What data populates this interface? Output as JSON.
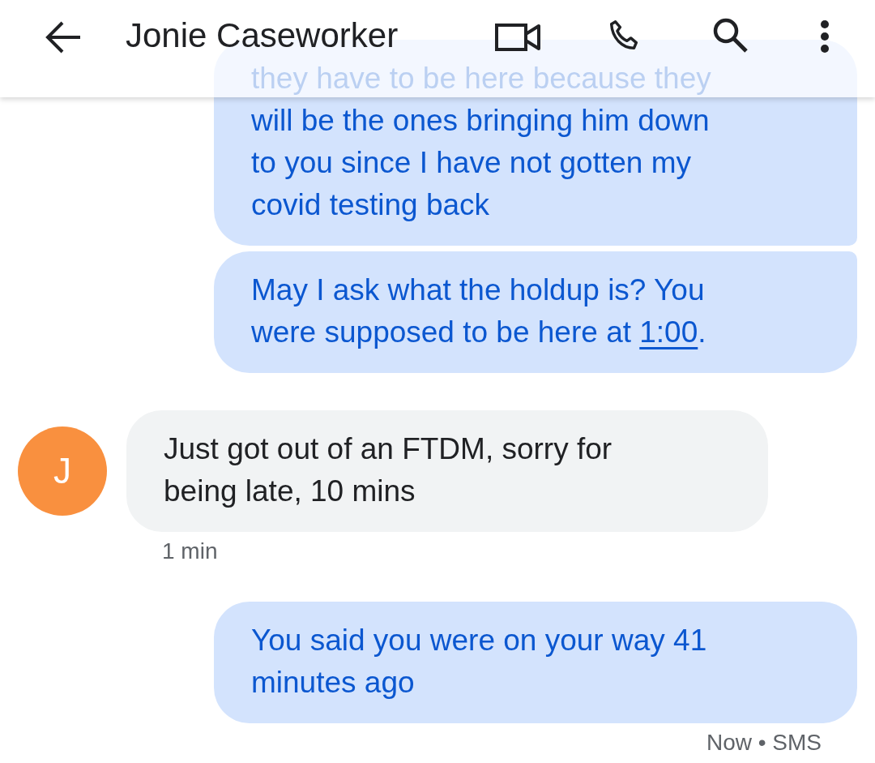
{
  "header": {
    "title": "Jonie Caseworker"
  },
  "messages": [
    {
      "kind": "sent",
      "lines": [
        [
          {
            "kind": "text",
            "text": "they have to be here because they"
          }
        ],
        [
          {
            "kind": "text",
            "text": "will be the ones bringing him down"
          }
        ],
        [
          {
            "kind": "text",
            "text": "to you since I have not gotten my"
          }
        ],
        [
          {
            "kind": "text",
            "text": "covid testing back"
          }
        ]
      ]
    },
    {
      "kind": "sent",
      "lines": [
        [
          {
            "kind": "text",
            "text": "May I ask what the holdup is? You"
          }
        ],
        [
          {
            "kind": "text",
            "text": "were supposed to be here at "
          },
          {
            "kind": "link",
            "text": "1:00"
          },
          {
            "kind": "text",
            "text": "."
          }
        ]
      ]
    },
    {
      "kind": "received",
      "avatar": "J",
      "time": "1 min",
      "lines": [
        [
          {
            "kind": "text",
            "text": "Just got out of an FTDM, sorry for"
          }
        ],
        [
          {
            "kind": "text",
            "text": "being late, 10 mins"
          }
        ]
      ]
    },
    {
      "kind": "sent",
      "status": "Now • SMS",
      "lines": [
        [
          {
            "kind": "text",
            "text": "You said you were on your way 41"
          }
        ],
        [
          {
            "kind": "text",
            "text": "minutes ago"
          }
        ]
      ]
    }
  ]
}
